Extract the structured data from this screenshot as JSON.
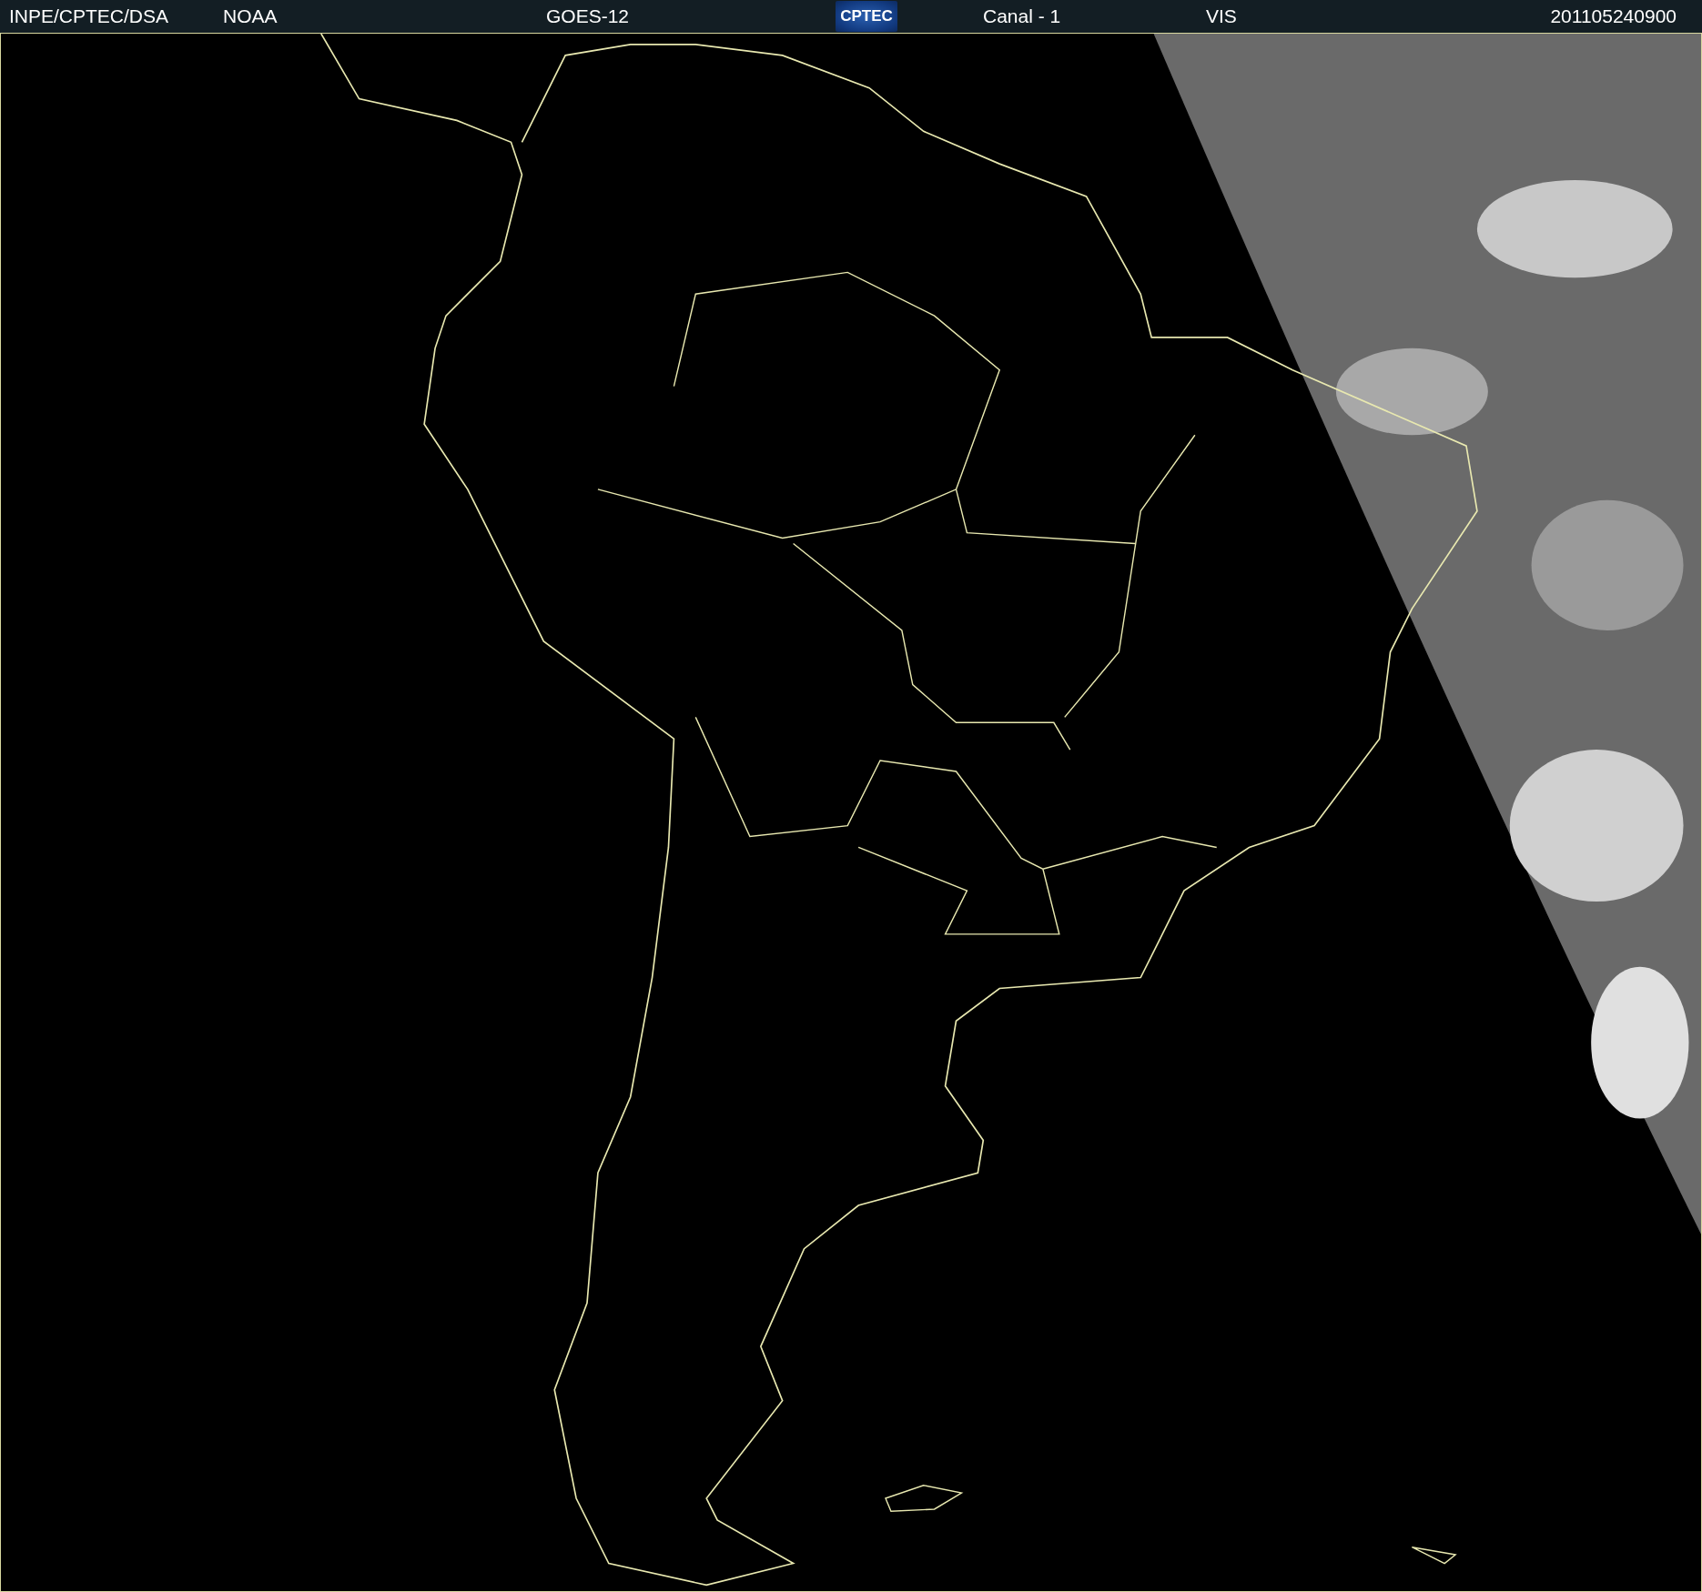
{
  "header": {
    "source": "INPE/CPTEC/DSA",
    "agency": "NOAA",
    "satellite": "GOES-12",
    "logo_text": "CPTEC",
    "channel": "Canal - 1",
    "band": "VIS",
    "timestamp": "201105240900"
  }
}
